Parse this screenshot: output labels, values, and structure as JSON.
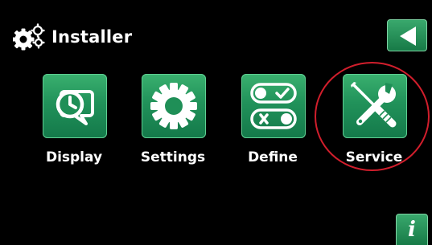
{
  "header": {
    "title": "Installer",
    "icon": "gears-icon"
  },
  "nav": {
    "back_icon": "back-arrow-icon"
  },
  "menu": {
    "items": [
      {
        "label": "Display",
        "icon": "display-clock-icon"
      },
      {
        "label": "Settings",
        "icon": "gear-icon"
      },
      {
        "label": "Define",
        "icon": "toggle-switches-icon"
      },
      {
        "label": "Service",
        "icon": "wrench-screwdriver-icon"
      }
    ]
  },
  "footer": {
    "info_label": "i",
    "info_icon": "info-icon"
  },
  "colors": {
    "background": "#000000",
    "tile_green": "#21925a",
    "highlight": "#d11e2c",
    "text": "#ffffff"
  }
}
